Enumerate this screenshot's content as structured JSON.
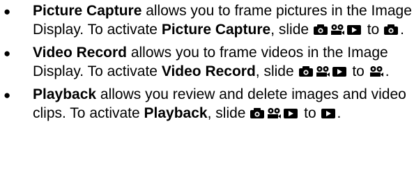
{
  "items": [
    {
      "title": "Picture Capture",
      "text1": " allows you to frame pictures in the Image Display. To activate ",
      "title2": "Picture Capture",
      "text2": ", slide ",
      "text3": " to ",
      "end": "."
    },
    {
      "title": "Video Record",
      "text1": " allows you to frame videos in the Image Display. To activate ",
      "title2": "Video Record",
      "text2": ", slide ",
      "text3": " to ",
      "end": "."
    },
    {
      "title": "Playback",
      "text1": " allows you review and delete images and video clips. To activate ",
      "title2": "Playback",
      "text2": ", slide ",
      "text3": " to ",
      "end": "."
    }
  ],
  "bullet_char": "●",
  "icons": [
    "camera-icon",
    "video-icon",
    "play-icon"
  ]
}
